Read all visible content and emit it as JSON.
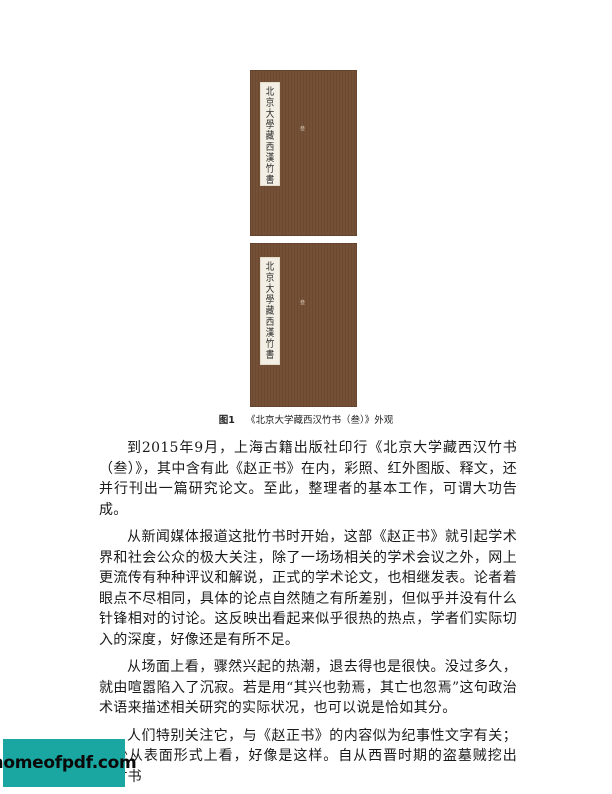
{
  "figure": {
    "spine_title_chars": [
      "北",
      "京",
      "大",
      "學",
      "藏",
      "西",
      "漢",
      "竹",
      "書"
    ],
    "volume_mark": "叁",
    "caption_number": "图1",
    "caption_text": "《北京大学藏西汉竹书（叁）》外观"
  },
  "paragraphs": [
    "到2015年9月，上海古籍出版社印行《北京大学藏西汉竹书（叁）》，其中含有此《赵正书》在内，彩照、红外图版、释文，还并行刊出一篇研究论文。至此，整理者的基本工作，可谓大功告成。",
    "从新闻媒体报道这批竹书时开始，这部《赵正书》就引起学术界和社会公众的极大关注，除了一场场相关的学术会议之外，网上更流传有种种评议和解说，正式的学术论文，也相继发表。论者着眼点不尽相同，具体的论点自然随之有所差别，但似乎并没有什么针锋相对的讨论。这反映出看起来似乎很热的热点，学者们实际切入的深度，好像还是有所不足。",
    "从场面上看，骤然兴起的热潮，退去得也是很快。没过多久，就由喧嚣陷入了沉寂。若是用“其兴也勃焉，其亡也忽焉”这句政治术语来描述相关研究的实际状况，也可以说是恰如其分。",
    "人们特别关注它，与《赵正书》的内容似为纪事性文字有关；至少从表面形式上看，好像是这样。自从西晋时期的盗墓贼挖出《竹书"
  ],
  "watermark": {
    "text": "homeofpdf.com"
  },
  "colors": {
    "book_cloth": "#6e4b33",
    "label": "#f4efe4",
    "seal": "#b4423a",
    "watermark_bg": "#1aa7a1"
  }
}
